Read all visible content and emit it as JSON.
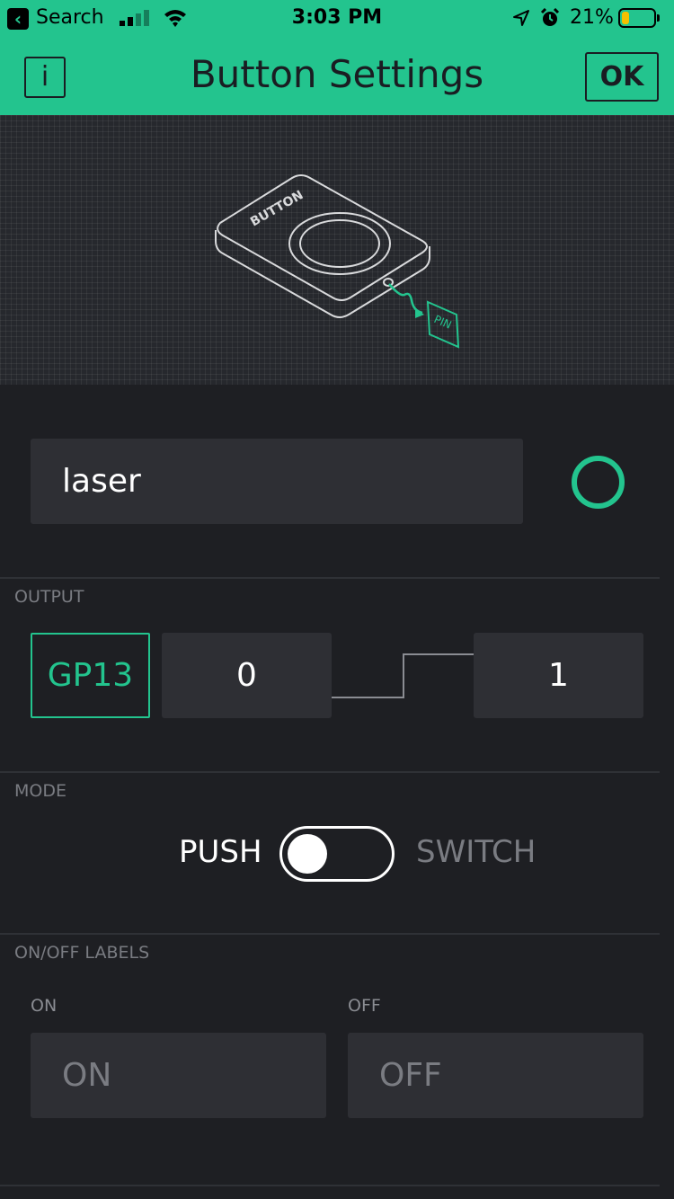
{
  "status_bar": {
    "back_app": "Search",
    "time": "3:03 PM",
    "battery_percent": "21%",
    "battery_level": 0.21
  },
  "header": {
    "title": "Button Settings",
    "info_label": "i",
    "ok_label": "OK",
    "background": "#23c48e"
  },
  "illustration": {
    "device_label": "BUTTON",
    "pin_label": "PIN"
  },
  "name_field": {
    "value": "laser",
    "color": "#23c48e"
  },
  "output": {
    "section_label": "OUTPUT",
    "pin": "GP13",
    "low_value": "0",
    "high_value": "1"
  },
  "mode": {
    "section_label": "MODE",
    "push_label": "PUSH",
    "switch_label": "SWITCH",
    "selected": "PUSH"
  },
  "onoff_labels": {
    "section_label": "ON/OFF LABELS",
    "on_caption": "ON",
    "off_caption": "OFF",
    "on_placeholder": "ON",
    "off_placeholder": "OFF"
  },
  "colors": {
    "accent": "#23c48e",
    "background": "#1e1f23",
    "field": "#2e2f34"
  }
}
